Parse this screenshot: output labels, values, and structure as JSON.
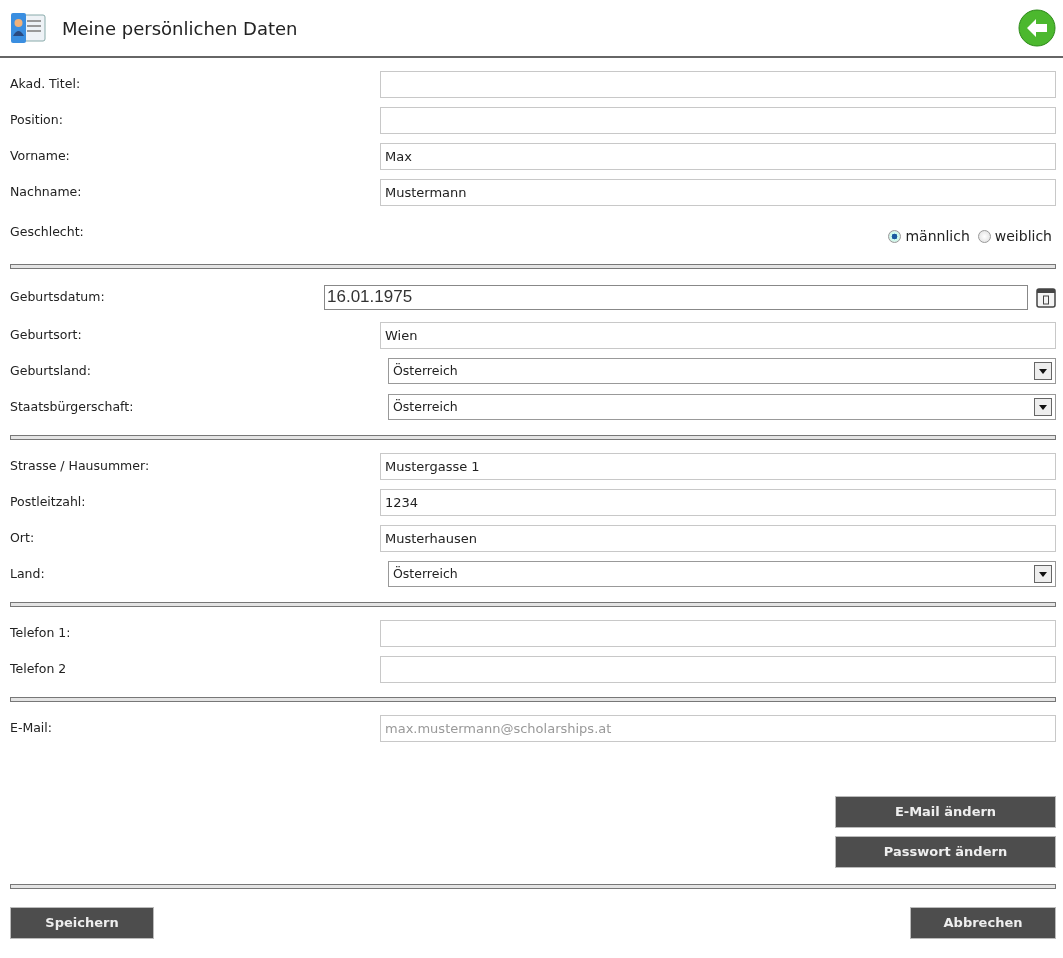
{
  "header": {
    "title": "Meine persönlichen Daten"
  },
  "sections": [
    {
      "fields": [
        {
          "kind": "text",
          "label": "Akad. Titel:"
        },
        {
          "kind": "text",
          "label": "Position:"
        },
        {
          "kind": "text",
          "label": "Vorname:",
          "value": "Max"
        },
        {
          "kind": "text",
          "label": "Nachname:",
          "value": "Mustermann"
        },
        {
          "kind": "radio",
          "label": "Geschlecht:",
          "options": [
            {
              "label": "männlich",
              "selected": true
            },
            {
              "label": "weiblich",
              "selected": false
            }
          ]
        }
      ]
    },
    {
      "fields": [
        {
          "kind": "date",
          "label": "Geburtsdatum:",
          "value": "16.01.1975"
        },
        {
          "kind": "text",
          "label": "Geburtsort:",
          "value": "Wien"
        },
        {
          "kind": "select",
          "label": "Geburtsland:",
          "value": "Österreich"
        },
        {
          "kind": "select",
          "label": "Staatsbürgerschaft:",
          "value": "Österreich"
        }
      ]
    },
    {
      "fields": [
        {
          "kind": "text",
          "label": "Strasse / Hausummer:",
          "value": "Mustergasse 1"
        },
        {
          "kind": "text",
          "label": "Postleitzahl:",
          "value": "1234"
        },
        {
          "kind": "text",
          "label": "Ort:",
          "value": "Musterhausen"
        },
        {
          "kind": "select",
          "label": "Land:",
          "value": "Österreich"
        }
      ]
    },
    {
      "fields": [
        {
          "kind": "text",
          "label": "Telefon 1:"
        },
        {
          "kind": "text",
          "label": "Telefon 2"
        }
      ]
    },
    {
      "fields": [
        {
          "kind": "text",
          "label": "E-Mail:",
          "value": "max.mustermann@scholarships.at",
          "disabled": true
        }
      ]
    }
  ],
  "account_buttons": [
    "E-Mail ändern",
    "Passwort ändern"
  ],
  "footer": {
    "save": "Speichern",
    "cancel": "Abbrechen"
  }
}
